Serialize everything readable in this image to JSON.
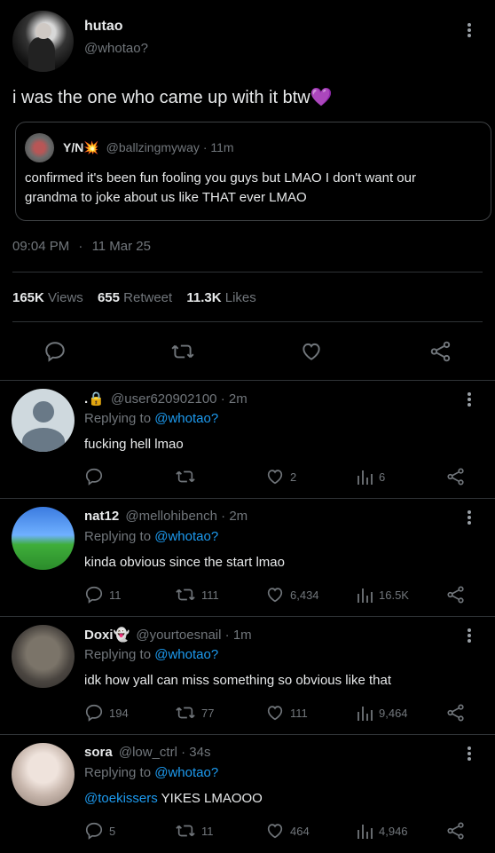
{
  "main_post": {
    "name": "hutao",
    "handle": "@whotao?",
    "text": "i was the one who came up with it btw💜",
    "quote": {
      "name": "Y/N💥",
      "handle": "@ballzingmyway",
      "time": "11m",
      "text": "confirmed it's been fun fooling you guys but LMAO I don't want our grandma to joke about us like THAT ever LMAO"
    },
    "time": "09:04 PM",
    "date": "11 Mar 25",
    "views_count": "165K",
    "views_label": "Views",
    "retweets_count": "655",
    "retweets_label": "Retweet",
    "likes_count": "11.3K",
    "likes_label": "Likes"
  },
  "replying_label": "Replying to",
  "replies": [
    {
      "name": ".🔒",
      "handle": "@user620902100",
      "time": "2m",
      "replying_to": "@whotao?",
      "text": "fucking hell lmao",
      "text_mention": "",
      "comments": "",
      "retweets": "",
      "likes": "2",
      "views": "6"
    },
    {
      "name": "nat12",
      "handle": "@mellohibench",
      "time": "2m",
      "replying_to": "@whotao?",
      "text": "kinda obvious since the start lmao",
      "text_mention": "",
      "comments": "11",
      "retweets": "111",
      "likes": "6,434",
      "views": "16.5K"
    },
    {
      "name": "Doxi👻",
      "handle": "@yourtoesnail",
      "time": "1m",
      "replying_to": "@whotao?",
      "text": "idk how yall can miss something so obvious like that",
      "text_mention": "",
      "comments": "194",
      "retweets": "77",
      "likes": "111",
      "views": "9,464"
    },
    {
      "name": "sora",
      "handle": "@low_ctrl",
      "time": "34s",
      "replying_to": "@whotao?",
      "text": " YIKES LMAOOO",
      "text_mention": "@toekissers",
      "comments": "5",
      "retweets": "11",
      "likes": "464",
      "views": "4,946"
    }
  ]
}
